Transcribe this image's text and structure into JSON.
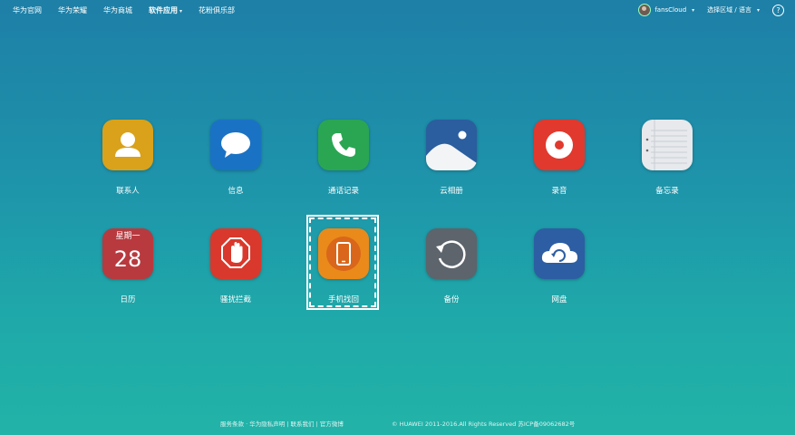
{
  "nav": {
    "items": [
      {
        "label": "华为官网"
      },
      {
        "label": "华为荣耀"
      },
      {
        "label": "华为商城"
      },
      {
        "label": "软件应用"
      },
      {
        "label": "花粉俱乐部"
      }
    ],
    "user_name": "fansCloud",
    "region_label": "选择区域 / 语言",
    "help_glyph": "?"
  },
  "apps": [
    {
      "label": "联系人",
      "color": "#d9a21a"
    },
    {
      "label": "信息",
      "color": "#1a72c4"
    },
    {
      "label": "通话记录",
      "color": "#2aa653"
    },
    {
      "label": "云相册",
      "color": "#2a5e9e"
    },
    {
      "label": "录音",
      "color": "#e1392e"
    },
    {
      "label": "备忘录",
      "color": "#e7e9ec"
    },
    {
      "label": "日历",
      "color": "#b83a3f",
      "weekday": "星期一",
      "day": "28"
    },
    {
      "label": "骚扰拦截",
      "color": "#d9392c"
    },
    {
      "label": "手机找回",
      "color": "#e98a1a"
    },
    {
      "label": "备份",
      "color": "#5d646b"
    },
    {
      "label": "网盘",
      "color": "#2d5ea3"
    }
  ],
  "footer": {
    "links": "服务条款 · 华为隐私声明  |  联系我们  |  官方微博",
    "copyright": "© HUAWEI 2011-2016.All Rights Reserved  苏ICP备09062682号"
  }
}
